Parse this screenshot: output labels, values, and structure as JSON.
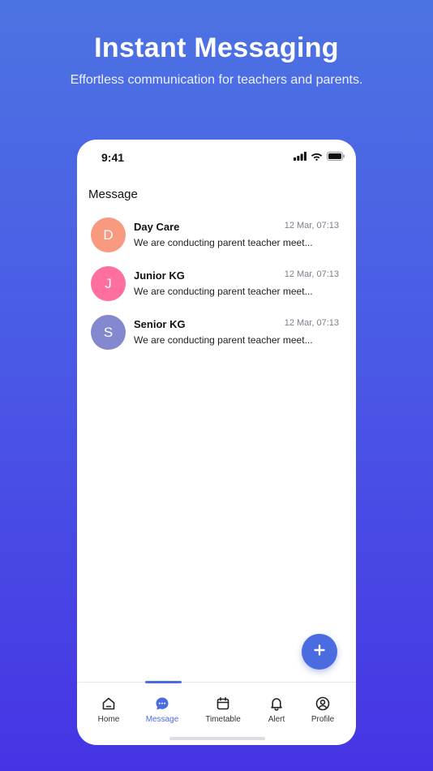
{
  "hero": {
    "title": "Instant Messaging",
    "subtitle": "Effortless communication for teachers and parents."
  },
  "status_bar": {
    "time": "9:41",
    "icons": [
      "signal-icon",
      "wifi-icon",
      "battery-icon"
    ]
  },
  "screen": {
    "title": "Message"
  },
  "chats": [
    {
      "initial": "D",
      "name": "Day Care",
      "time": "12 Mar, 07:13",
      "preview": "We are conducting parent teacher meet...",
      "color": "#f79a80"
    },
    {
      "initial": "J",
      "name": "Junior KG",
      "time": "12 Mar, 07:13",
      "preview": "We are conducting parent teacher meet...",
      "color": "#fd6f9e"
    },
    {
      "initial": "S",
      "name": "Senior KG",
      "time": "12 Mar, 07:13",
      "preview": "We are conducting parent teacher meet...",
      "color": "#8489cf"
    }
  ],
  "fab": {
    "icon": "plus-icon"
  },
  "bottom_nav": {
    "active": "Message",
    "items": [
      {
        "label": "Home",
        "icon": "home-icon"
      },
      {
        "label": "Message",
        "icon": "chat-bubble-icon"
      },
      {
        "label": "Timetable",
        "icon": "calendar-icon"
      },
      {
        "label": "Alert",
        "icon": "bell-icon"
      },
      {
        "label": "Profile",
        "icon": "user-circle-icon"
      }
    ]
  },
  "colors": {
    "accent": "#4b6be0",
    "background_top": "#4c73e2",
    "background_bottom": "#4634e4"
  }
}
